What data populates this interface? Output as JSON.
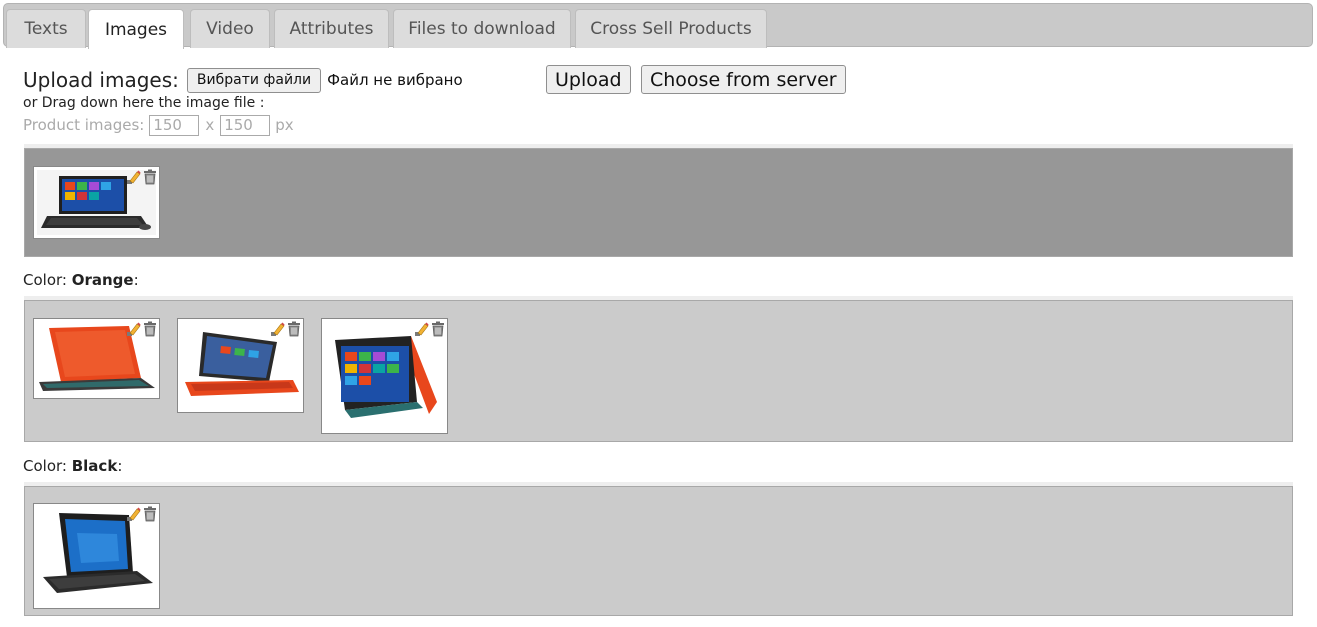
{
  "tabs": [
    {
      "label": "Texts",
      "active": false
    },
    {
      "label": "Images",
      "active": true
    },
    {
      "label": "Video",
      "active": false
    },
    {
      "label": "Attributes",
      "active": false
    },
    {
      "label": "Files to download",
      "active": false
    },
    {
      "label": "Cross Sell Products",
      "active": false
    }
  ],
  "upload": {
    "label": "Upload images:",
    "file_button": "Вибрати файли",
    "file_status": "Файл не вибрано",
    "upload_button": "Upload",
    "server_button": "Choose from server",
    "drag_hint": "or Drag down here the image file :"
  },
  "image_size": {
    "label": "Product images:",
    "width": "150",
    "separator": "x",
    "height": "150",
    "unit": "px"
  },
  "sections": [
    {
      "name_label": "",
      "name_value": "",
      "style": "dark",
      "images": [
        {
          "icon": "laptop-black-screen-icon",
          "edit_icon": "pencil-icon",
          "delete_icon": "trash-icon"
        }
      ]
    },
    {
      "name_label": "Color:",
      "name_value": "Orange",
      "suffix": ":",
      "style": "light",
      "images": [
        {
          "icon": "laptop-orange-open-icon",
          "edit_icon": "pencil-icon",
          "delete_icon": "trash-icon"
        },
        {
          "icon": "laptop-orange-tilt-icon",
          "edit_icon": "pencil-icon",
          "delete_icon": "trash-icon"
        },
        {
          "icon": "laptop-orange-tent-icon",
          "edit_icon": "pencil-icon",
          "delete_icon": "trash-icon"
        }
      ]
    },
    {
      "name_label": "Color:",
      "name_value": "Black",
      "suffix": ":",
      "style": "light",
      "images": [
        {
          "icon": "laptop-black-stand-icon",
          "edit_icon": "pencil-icon",
          "delete_icon": "trash-icon"
        }
      ]
    }
  ],
  "colors": {
    "tab_bar": "#c9c9c9",
    "gallery_dark": "#979797",
    "gallery_light": "#cbcbcb",
    "laptop_orange": "#e8471c",
    "laptop_black": "#2b2b2b",
    "screen_blue": "#1c4fa8"
  }
}
